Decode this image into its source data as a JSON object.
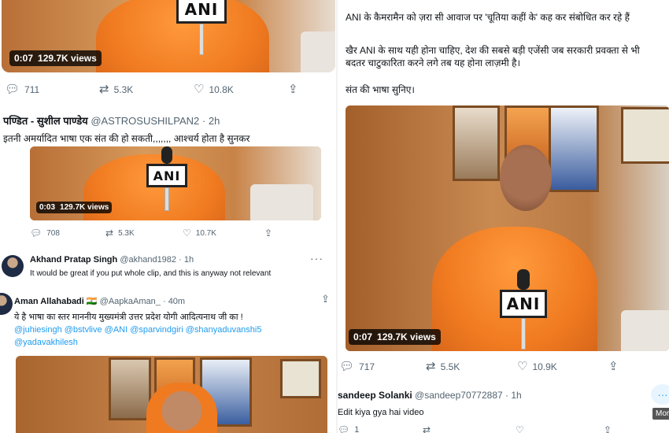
{
  "left": {
    "tweet1": {
      "video": {
        "time": "0:07",
        "views": "129.7K views",
        "mic_logo": "ANI"
      },
      "actions": {
        "replies": "711",
        "retweets": "5.3K",
        "likes": "10.8K"
      }
    },
    "tweet2": {
      "author_name": "पण्डित - सुशील पाण्डेय",
      "handle": "@ASTROSUSHILPAN2",
      "dot": "·",
      "time": "2h",
      "text": "इतनी अमर्यादित भाषा एक संत की हो सकती,,,,,,, आश्चर्य होता है सुनकर",
      "video": {
        "time": "0:03",
        "views": "129.7K views",
        "mic_logo": "ANI"
      },
      "actions": {
        "replies": "708",
        "retweets": "5.3K",
        "likes": "10.7K"
      }
    },
    "reply1": {
      "author_name": "Akhand Pratap Singh",
      "handle": "@akhand1982",
      "dot": "·",
      "time": "1h",
      "text": "It would be great if you put whole clip, and this is anyway not relevant",
      "more": "···"
    },
    "reply2": {
      "author_name": "Aman Allahabadi",
      "flag": "🇮🇳",
      "handle": "@AapkaAman_",
      "dot": "·",
      "time": "40m",
      "text": "ये है भाषा का स्तर माननीय मुख्यमंत्री उत्तर प्रदेश योगी आदित्यनाथ जी का !",
      "mentions_line1": "@juhiesingh @bstvlive @ANI @sparvindgiri @shanyaduvanshi5",
      "mentions_line2": "@yadavakhilesh"
    }
  },
  "right": {
    "tweet": {
      "line1": "ANI के कैमरामैन को ज़रा सी आवाज पर 'चूतिया कहीं के' कह कर संबोधित कर रहे हैं",
      "line2": "खैर ANI के साथ यही होना चाहिए, देश की सबसे बड़ी एजेंसी जब सरकारी प्रवक्ता से भी",
      "line3": "बदतर चाटुकारिता करने लगे तब यह होना लाज़मी है।",
      "line4": "संत की भाषा सुनिए।",
      "video": {
        "time": "0:07",
        "views": "129.7K views",
        "mic_logo": "ANI"
      },
      "actions": {
        "replies": "717",
        "retweets": "5.5K",
        "likes": "10.9K"
      }
    },
    "reply": {
      "author_name": "sandeep Solanki",
      "handle": "@sandeep70772887",
      "dot": "·",
      "time": "1h",
      "text": "Edit kiya gya hai video",
      "more": "···",
      "tooltip": "Mor",
      "action_count": "1"
    }
  },
  "colors": {
    "accent": "#1d9bf0",
    "robe": "#f07a20",
    "muted": "#536471"
  },
  "icons": {
    "reply": "reply-icon",
    "retweet": "retweet-icon",
    "like": "heart-icon",
    "share": "share-icon",
    "more": "more-icon"
  }
}
